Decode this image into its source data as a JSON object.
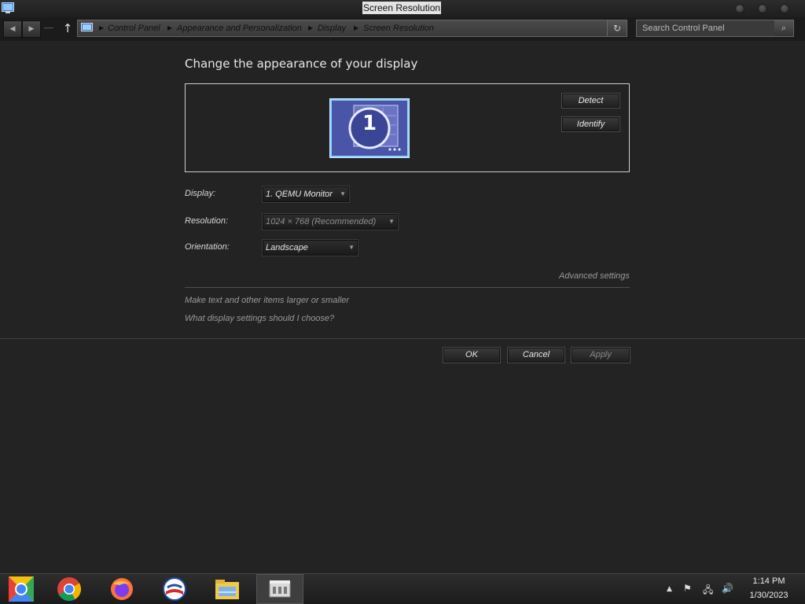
{
  "window": {
    "title": "Screen Resolution"
  },
  "address": {
    "breadcrumbs": [
      "Control Panel",
      "Appearance and Personalization",
      "Display",
      "Screen Resolution"
    ],
    "search_placeholder": "Search Control Panel"
  },
  "main": {
    "heading": "Change the appearance of your display",
    "monitor_number": "1",
    "detect_label": "Detect",
    "identify_label": "Identify",
    "display_label": "Display:",
    "display_value": "1. QEMU Monitor",
    "resolution_label": "Resolution:",
    "resolution_value": "1024 × 768 (Recommended)",
    "orientation_label": "Orientation:",
    "orientation_value": "Landscape",
    "advanced_link": "Advanced settings",
    "text_size_link": "Make text and other items larger or smaller",
    "help_link": "What display settings should I choose?"
  },
  "footer": {
    "ok_label": "OK",
    "cancel_label": "Cancel",
    "apply_label": "Apply"
  },
  "taskbar": {
    "apps": [
      "chrome-canary-icon",
      "chrome-icon",
      "firefox-icon",
      "app-circle-icon",
      "file-explorer-icon",
      "control-panel-icon"
    ],
    "clock_time": "1:14 PM",
    "clock_date": "1/30/2023"
  },
  "colors": {
    "background": "#232323",
    "monitor_blue": "#4a55a8",
    "monitor_border": "#8fd0ff"
  }
}
